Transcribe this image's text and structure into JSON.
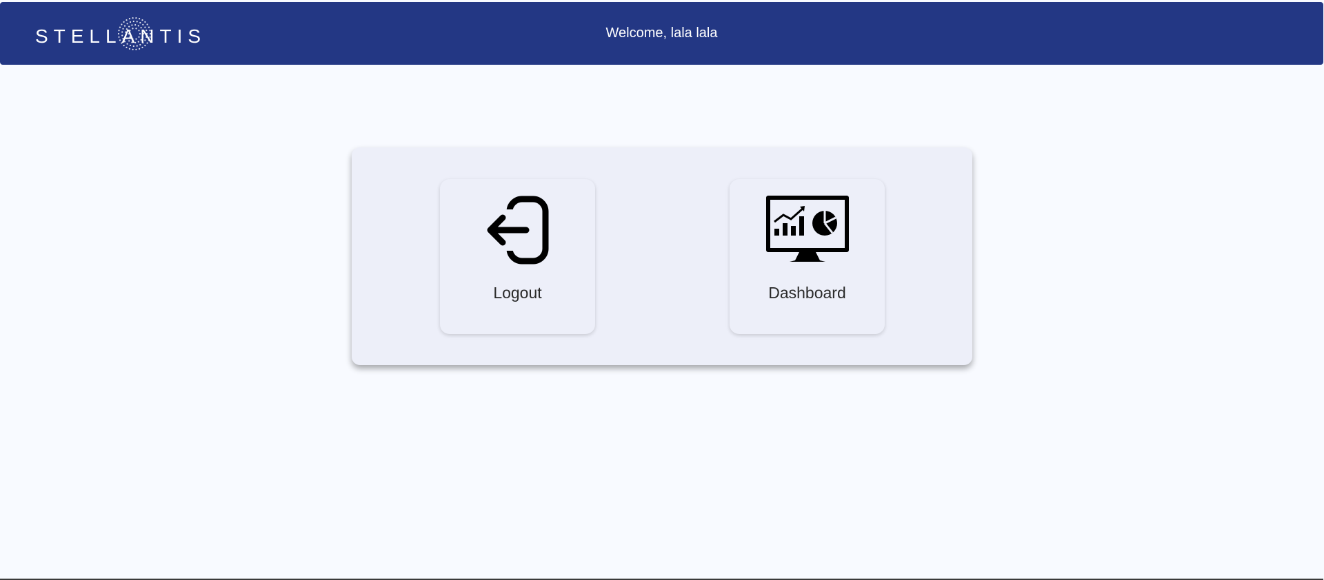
{
  "header": {
    "logo_text": "STELLANTIS",
    "welcome": "Welcome, lala lala",
    "background": "#233784"
  },
  "tiles": [
    {
      "label": "Logout",
      "icon": "logout-icon"
    },
    {
      "label": "Dashboard",
      "icon": "dashboard-monitor-icon"
    }
  ]
}
